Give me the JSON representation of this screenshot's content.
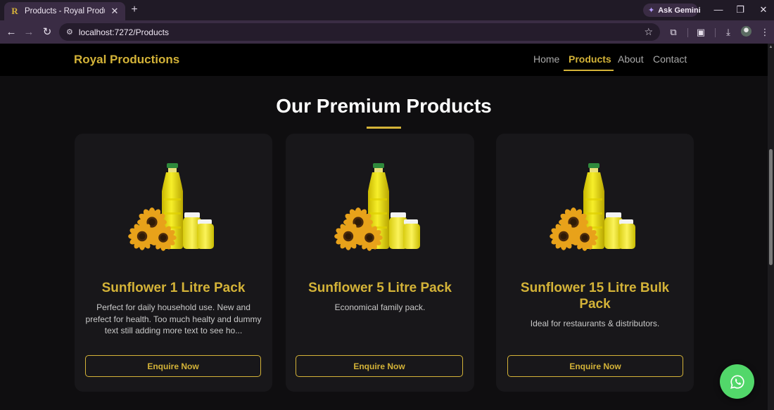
{
  "browser": {
    "tab_title": "Products - Royal Productions",
    "tab_favicon": "R",
    "new_tab": "+",
    "gemini_label": "Ask Gemini",
    "url": "localhost:7272/Products"
  },
  "site": {
    "brand": "Royal Productions",
    "nav": [
      {
        "label": "Home",
        "active": false
      },
      {
        "label": "Products",
        "active": true
      },
      {
        "label": "About",
        "active": false
      },
      {
        "label": "Contact",
        "active": false
      }
    ]
  },
  "page": {
    "title": "Our Premium Products"
  },
  "products": [
    {
      "name": "Sunflower 1 Litre Pack",
      "description": "Perfect for daily household use. New and prefect for health. Too much healty and dummy text still adding more text to see ho...",
      "button": "Enquire Now",
      "image": "sunflower-oil-bottle-image"
    },
    {
      "name": "Sunflower 5 Litre Pack",
      "description": "Economical family pack.",
      "button": "Enquire Now",
      "image": "sunflower-oil-bottle-image"
    },
    {
      "name": "Sunflower 15 Litre Bulk Pack",
      "description": "Ideal for restaurants & distributors.",
      "button": "Enquire Now",
      "image": "sunflower-oil-bottle-image"
    }
  ],
  "floating": {
    "icon": "whatsapp-icon"
  },
  "colors": {
    "accent": "#d4b338",
    "background": "#0f0e10",
    "card": "#18171a",
    "whatsapp": "#52d76a"
  }
}
